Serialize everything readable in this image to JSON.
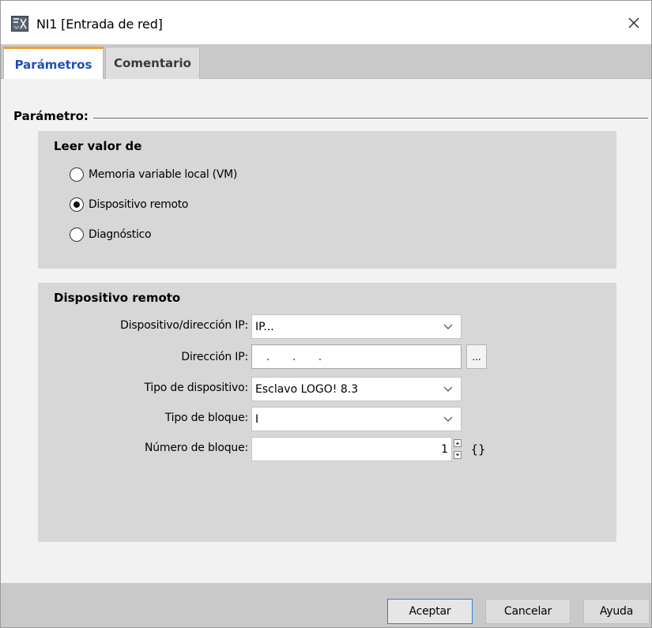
{
  "window": {
    "title": "NI1 [Entrada de red]",
    "close_glyph": "✕"
  },
  "tabs": [
    {
      "label": "Parámetros",
      "active": true
    },
    {
      "label": "Comentario",
      "active": false
    }
  ],
  "parametro_section": {
    "label": "Parámetro:"
  },
  "read_group": {
    "title": "Leer valor de",
    "options": [
      {
        "label": "Memoria variable local (VM)",
        "selected": false
      },
      {
        "label": "Dispositivo remoto",
        "selected": true
      },
      {
        "label": "Diagnóstico",
        "selected": false
      }
    ]
  },
  "remote_group": {
    "title": "Dispositivo remoto",
    "fields": {
      "device_ip": {
        "label": "Dispositivo/dirección IP:",
        "value": "IP..."
      },
      "ip_address": {
        "label": "Dirección IP:",
        "value": ". . .",
        "button_label": "..."
      },
      "device_type": {
        "label": "Tipo de dispositivo:",
        "value": "Esclavo LOGO! 8.3"
      },
      "block_type": {
        "label": "Tipo de bloque:",
        "value": "I"
      },
      "block_number": {
        "label": "Número de bloque:",
        "value": "1",
        "brace_label": "{}"
      }
    }
  },
  "footer": {
    "accept_label": "Aceptar",
    "cancel_label": "Cancelar",
    "help_label": "Ayuda"
  },
  "colors": {
    "active_tab_text": "#1f4fb8",
    "active_tab_accent": "#f29c38",
    "primary_button_border": "#3b7bd8"
  },
  "icons": {
    "app": "logo-app-icon",
    "close": "close-icon",
    "dropdown": "chevron-down-icon",
    "spin_up": "spin-up-icon",
    "spin_down": "spin-down-icon"
  }
}
